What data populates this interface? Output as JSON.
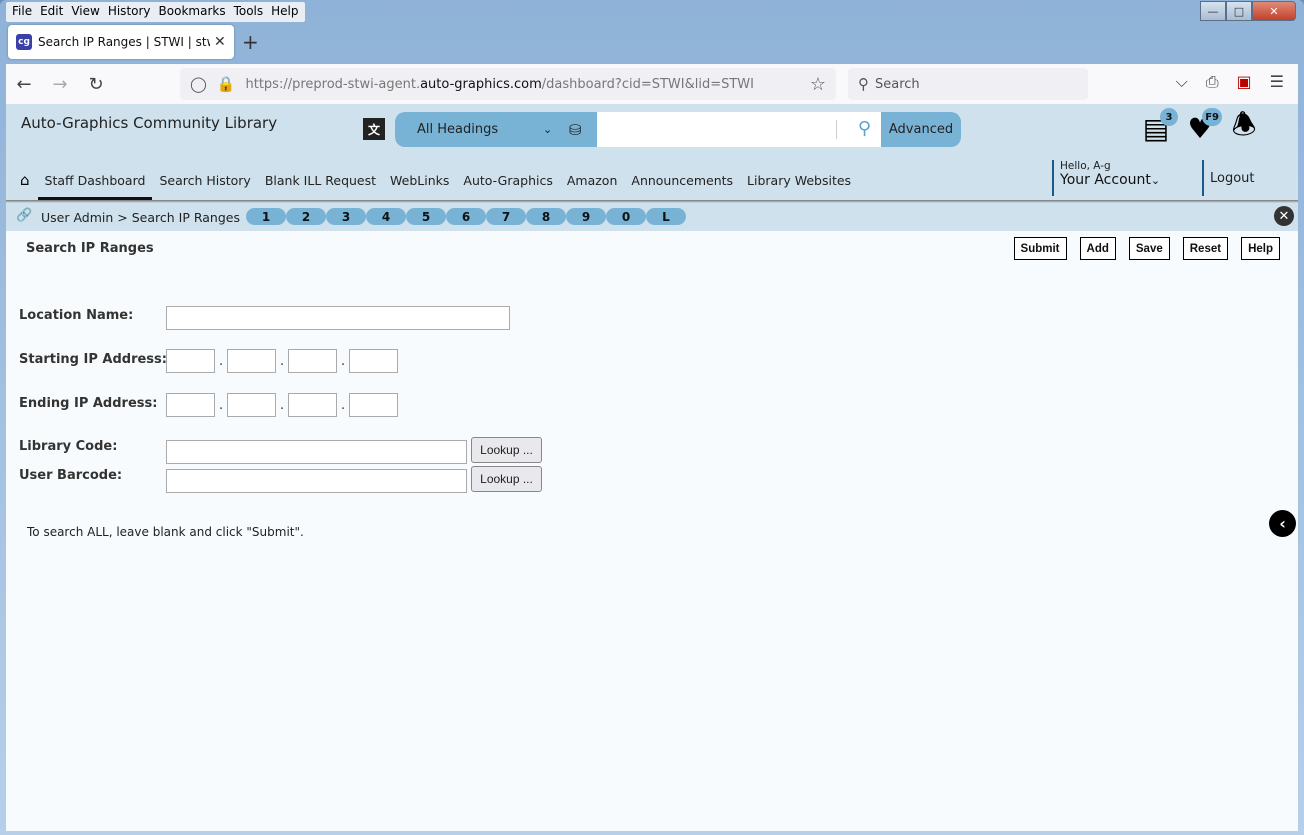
{
  "browser": {
    "menu": [
      "File",
      "Edit",
      "View",
      "History",
      "Bookmarks",
      "Tools",
      "Help"
    ],
    "tab_title": "Search IP Ranges | STWI | stwi | A",
    "url_prefix": "https://preprod-stwi-agent.",
    "url_domain": "auto-graphics.com",
    "url_suffix": "/dashboard?cid=STWI&lid=STWI",
    "search_placeholder": "Search"
  },
  "header": {
    "library_name": "Auto-Graphics Community Library",
    "search_scope": "All Headings",
    "search_value": "",
    "advanced_label": "Advanced",
    "list_badge": "3",
    "favorites_badge": "F9",
    "greeting": "Hello, A-g",
    "account_label": "Your Account",
    "logout_label": "Logout"
  },
  "nav": {
    "items": [
      "Staff Dashboard",
      "Search History",
      "Blank ILL Request",
      "WebLinks",
      "Auto-Graphics",
      "Amazon",
      "Announcements",
      "Library Websites"
    ],
    "active": "Staff Dashboard"
  },
  "breadcrumb": {
    "text": "User Admin > Search IP Ranges",
    "quick_keys": [
      "1",
      "2",
      "3",
      "4",
      "5",
      "6",
      "7",
      "8",
      "9",
      "0",
      "L"
    ]
  },
  "page": {
    "title": "Search IP Ranges",
    "actions": [
      "Submit",
      "Add",
      "Save",
      "Reset",
      "Help"
    ],
    "form": {
      "location_name_label": "Location Name:",
      "location_name_value": "",
      "starting_ip_label": "Starting IP Address:",
      "starting_ip": [
        "",
        "",
        "",
        ""
      ],
      "ending_ip_label": "Ending IP Address:",
      "ending_ip": [
        "",
        "",
        "",
        ""
      ],
      "library_code_label": "Library Code:",
      "library_code_value": "",
      "user_barcode_label": "User Barcode:",
      "user_barcode_value": "",
      "lookup_label": "Lookup ..."
    },
    "hint": "To search ALL, leave blank and click \"Submit\"."
  }
}
